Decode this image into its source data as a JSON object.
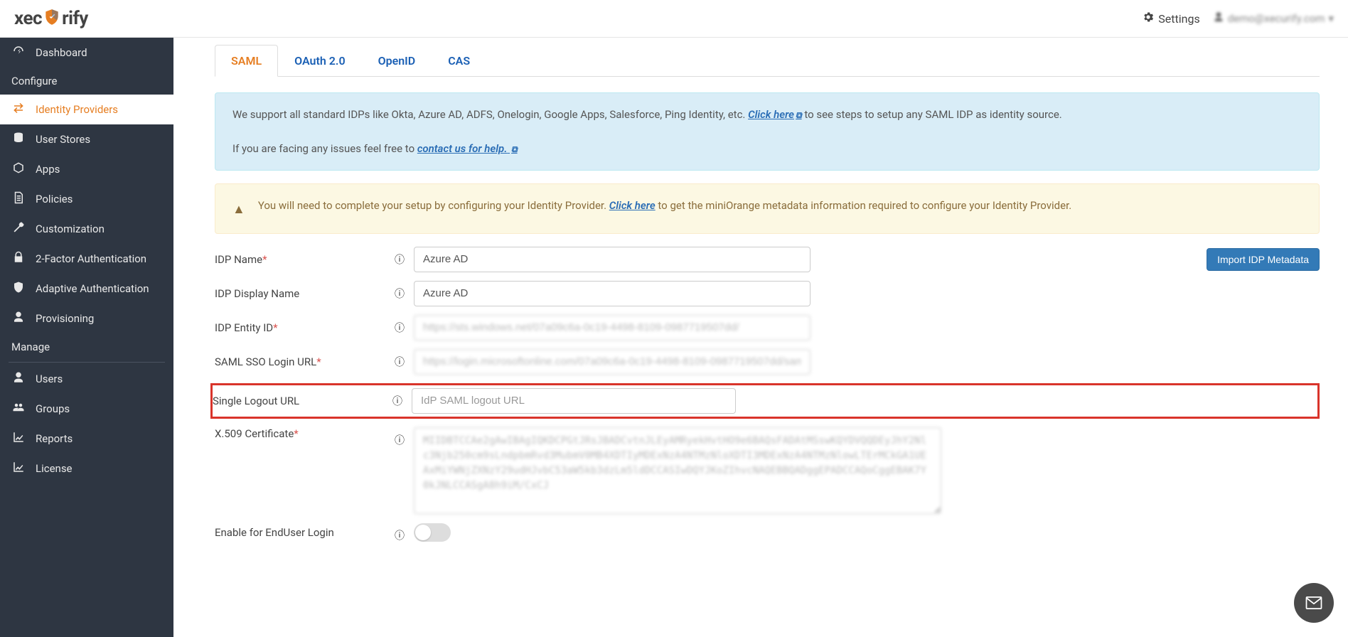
{
  "brand": {
    "name_left": "xec",
    "name_right": "rify"
  },
  "top": {
    "settings": "Settings",
    "user_email": "demo@xecurify.com"
  },
  "sidebar": {
    "items": [
      {
        "icon": "dashboard",
        "label": "Dashboard"
      },
      {
        "heading": "Configure"
      },
      {
        "icon": "exchange",
        "label": "Identity Providers",
        "active": true
      },
      {
        "icon": "database",
        "label": "User Stores"
      },
      {
        "icon": "cube",
        "label": "Apps"
      },
      {
        "icon": "file",
        "label": "Policies"
      },
      {
        "icon": "wrench",
        "label": "Customization"
      },
      {
        "icon": "lock",
        "label": "2-Factor Authentication"
      },
      {
        "icon": "shield",
        "label": "Adaptive Authentication"
      },
      {
        "icon": "user",
        "label": "Provisioning"
      },
      {
        "heading": "Manage",
        "divider": true
      },
      {
        "icon": "user",
        "label": "Users"
      },
      {
        "icon": "users",
        "label": "Groups"
      },
      {
        "icon": "chart",
        "label": "Reports"
      },
      {
        "icon": "chart",
        "label": "License"
      }
    ]
  },
  "tabs": [
    {
      "label": "SAML",
      "active": true
    },
    {
      "label": "OAuth 2.0"
    },
    {
      "label": "OpenID"
    },
    {
      "label": "CAS"
    }
  ],
  "info_alert": {
    "line1_a": "We support all standard IDPs like Okta, Azure AD, ADFS, Onelogin, Google Apps, Salesforce, Ping Identity, etc. ",
    "link1": "Click here",
    "line1_b": " to see steps to setup any SAML IDP as identity source.",
    "line2_a": "If you are facing any issues feel free to ",
    "link2": "contact us for help."
  },
  "warn_alert": {
    "text_a": "You will need to complete your setup by configuring your Identity Provider. ",
    "link": "Click here",
    "text_b": " to get the miniOrange metadata information required to configure your Identity Provider."
  },
  "buttons": {
    "import": "Import IDP Metadata"
  },
  "form": {
    "idp_name": {
      "label": "IDP Name",
      "value": "Azure AD",
      "required": true
    },
    "idp_display": {
      "label": "IDP Display Name",
      "value": "Azure AD"
    },
    "entity_id": {
      "label": "IDP Entity ID",
      "value": "https://sts.windows.net/07a09c6a-0c19-4498-8109-0987719507dd/",
      "required": true
    },
    "sso_url": {
      "label": "SAML SSO Login URL",
      "value": "https://login.microsoftonline.com/07a09c6a-0c19-4498-8109-0987719507dd/saml2",
      "required": true
    },
    "slo_url": {
      "label": "Single Logout URL",
      "placeholder": "IdP SAML logout URL",
      "value": ""
    },
    "cert": {
      "label": "X.509 Certificate",
      "required": true,
      "value": "MIIDBTCCAe2gAwIBAgIQKDCPGtJRsJBADCvtnJLEyAMRyekHvtHO9e6BAQsFADAtMSswKQYDVQQDEyJhY2Nlc3Njb250cm9sLndpbmRvd3MubmV0MB4XDTIyMDExNzA4NTMzNloXDTI3MDExNzA4NTMzNlowLTErMCkGA1UEAxMiYWNjZXNzY29udHJvbC53aW5kb3dzLm5ldDCCASIwDQYJKoZIhvcNAQEBBQADggEPADCCAQoCggEBAK7Y0kJNLCCASgA8h9iM/CxCJ"
    },
    "enable": {
      "label": "Enable for EndUser Login",
      "value": false
    }
  }
}
